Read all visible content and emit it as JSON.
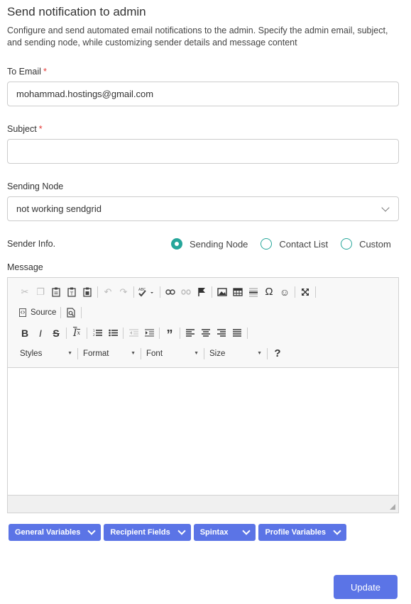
{
  "header": {
    "title": "Send notification to admin",
    "description": "Configure and send automated email notifications to the admin. Specify the admin email, subject, and sending node, while customizing sender details and message content"
  },
  "form": {
    "to_email": {
      "label": "To Email",
      "required_mark": "*",
      "value": "mohammad.hostings@gmail.com"
    },
    "subject": {
      "label": "Subject",
      "required_mark": "*",
      "value": ""
    },
    "sending_node": {
      "label": "Sending Node",
      "selected": "not working sendgrid"
    },
    "sender_info": {
      "label": "Sender Info.",
      "options": [
        "Sending Node",
        "Contact List",
        "Custom"
      ],
      "selected": "Sending Node"
    },
    "message": {
      "label": "Message"
    }
  },
  "editor": {
    "source_label": "Source",
    "combos": [
      "Styles",
      "Format",
      "Font",
      "Size"
    ],
    "help_glyph": "?",
    "accent": "#26a69a"
  },
  "variables": {
    "buttons": [
      "General Variables",
      "Recipient Fields",
      "Spintax",
      "Profile Variables"
    ],
    "color": "#5b74e6"
  },
  "actions": {
    "update_label": "Update"
  }
}
